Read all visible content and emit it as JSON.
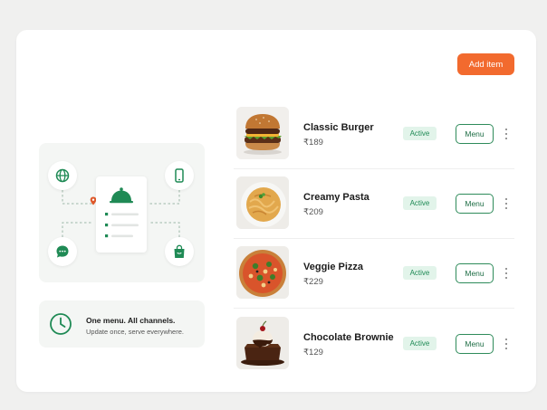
{
  "header": {
    "add_label": "Add item"
  },
  "info": {
    "title": "One menu. All channels.",
    "subtitle": "Update once, serve everywhere."
  },
  "items": [
    {
      "name": "Classic Burger",
      "price": "₹189",
      "status": "Active",
      "action": "Menu",
      "icon": "burger-photo"
    },
    {
      "name": "Creamy Pasta",
      "price": "₹209",
      "status": "Active",
      "action": "Menu",
      "icon": "pasta-photo"
    },
    {
      "name": "Veggie Pizza",
      "price": "₹229",
      "status": "Active",
      "action": "Menu",
      "icon": "pizza-photo"
    },
    {
      "name": "Chocolate Brownie",
      "price": "₹129",
      "status": "Active",
      "action": "Menu",
      "icon": "brownie-photo"
    }
  ],
  "colors": {
    "accent": "#f26a2e",
    "brand_green": "#1f8a55",
    "badge_bg": "#e2f4ea"
  }
}
